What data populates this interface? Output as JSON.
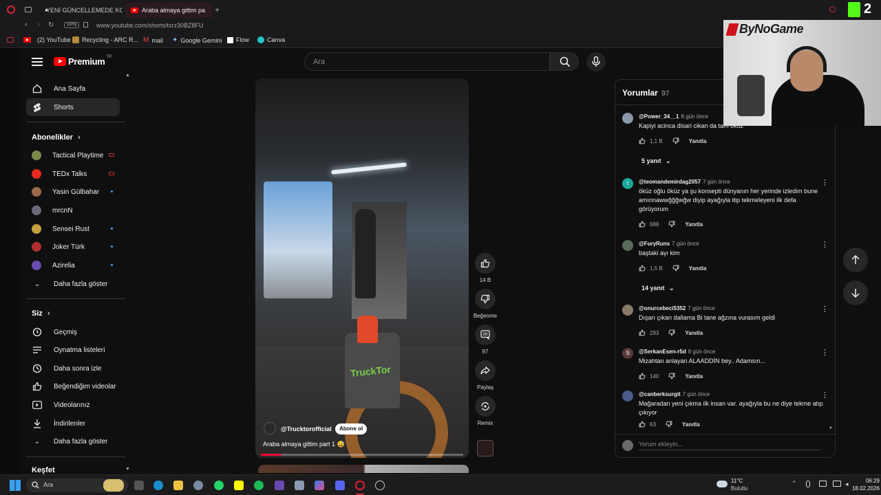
{
  "browser": {
    "tabs": [
      {
        "label": "YENİ GÜNCELLEMEDE KO"
      },
      {
        "label": "Araba almaya gittim pa"
      }
    ],
    "url": "www.youtube.com/shorts/txrz30BZ8FU",
    "vpn": "VPN",
    "bookmarks": [
      {
        "label": "(2) YouTube"
      },
      {
        "label": "Recycling - ARC R..."
      },
      {
        "label": "mail"
      },
      {
        "label": "Google Gemini"
      },
      {
        "label": "Flow"
      },
      {
        "label": "Canva"
      }
    ]
  },
  "header": {
    "logo": "Premium",
    "logo_sup": "TR",
    "search_placeholder": "Ara"
  },
  "sidebar": {
    "main": [
      {
        "label": "Ana Sayfa",
        "icon": "home-icon"
      },
      {
        "label": "Shorts",
        "icon": "shorts-icon"
      }
    ],
    "subs_title": "Abonelikler",
    "subs": [
      {
        "label": "Tactical Playtime",
        "color": "#7a8a4a"
      },
      {
        "label": "TEDx Talks",
        "color": "#e62b1e"
      },
      {
        "label": "Yasin Gülbahar",
        "color": "#9a6a4a"
      },
      {
        "label": "mrcnN",
        "color": "#6a6a7a"
      },
      {
        "label": "Sensei Rust",
        "color": "#c8a040"
      },
      {
        "label": "Joker Türk",
        "color": "#b03030"
      },
      {
        "label": "Azirelia",
        "color": "#6a4ab0"
      }
    ],
    "more_subs": "Daha fazla göster",
    "you_title": "Siz",
    "you": [
      {
        "label": "Geçmiş",
        "icon": "history-icon"
      },
      {
        "label": "Oynatma listeleri",
        "icon": "playlist-icon"
      },
      {
        "label": "Daha sonra izle",
        "icon": "clock-icon"
      },
      {
        "label": "Beğendiğim videolar",
        "icon": "like-icon"
      },
      {
        "label": "Videolarınız",
        "icon": "video-icon"
      },
      {
        "label": "İndirilenler",
        "icon": "download-icon"
      }
    ],
    "more_you": "Daha fazla göster",
    "explore_title": "Keşfet"
  },
  "video": {
    "channel": "@Trucktorofficial",
    "subscribe": "Abone ol",
    "title": "Araba almaya gittim part 1 😅",
    "sign_text": "TruckTor",
    "progress": 0.1
  },
  "actions": {
    "likes": "14 B",
    "dislike": "Beğenme",
    "comments": "97",
    "share": "Paylaş",
    "remix": "Remix"
  },
  "comments_panel": {
    "title": "Yorumlar",
    "count": "97",
    "input_placeholder": "Yorum ekleyin...",
    "comments": [
      {
        "author": "@Power_34__1",
        "time": "8 gün önce",
        "text": "Kapiyi acinca disari cikan da tam öküz",
        "likes": "1,1 B",
        "reply": "Yanıtla",
        "color": "#8a9aa8",
        "replies": "5 yanıt"
      },
      {
        "author": "@teomandemirdag2057",
        "time": "7 gün önce",
        "text": "öküz oğlu öküz ya şu konsepti dünyanın her yerinde izledim bune amınnawwğğğwğw diyip ayağıyla itip tekmeleyeni ilk defa görüyorum",
        "likes": "688",
        "reply": "Yanıtla",
        "color": "#1aa89a",
        "initial": "t"
      },
      {
        "author": "@FuryRuns",
        "time": "7 gün önce",
        "text": "baştaki ayı kim",
        "likes": "1,5 B",
        "reply": "Yanıtla",
        "color": "#5a6a5a",
        "replies": "14 yanıt"
      },
      {
        "author": "@onurcebeci5352",
        "time": "7 gün önce",
        "text": "Dışarı çıkan dallama Bi tane ağzına vurasım geldi",
        "likes": "293",
        "reply": "Yanıtla",
        "color": "#8a7a6a"
      },
      {
        "author": "@SerkanEsen-r5d",
        "time": "8 gün önce",
        "text": "Mizahtan anlayan ALAADDİN bey.. Adamsın...",
        "likes": "140",
        "reply": "Yanıtla",
        "color": "#5a3a3a",
        "initial": "S"
      },
      {
        "author": "@canberksurgit",
        "time": "7 gün önce",
        "text": "Mağaradan yeni çıkma ilk insan var. ayağıyla bu ne diye tekme atıp çıkıyor",
        "likes": "63",
        "reply": "Yanıtla",
        "color": "#4a5a8a"
      }
    ]
  },
  "stream": {
    "brand": "ByNoGame",
    "k_number": "2"
  },
  "taskbar": {
    "search": "Ara",
    "weather_temp": "11°C",
    "weather_desc": "Bulutlu",
    "time": "06:29",
    "date": "18.02.2026"
  }
}
